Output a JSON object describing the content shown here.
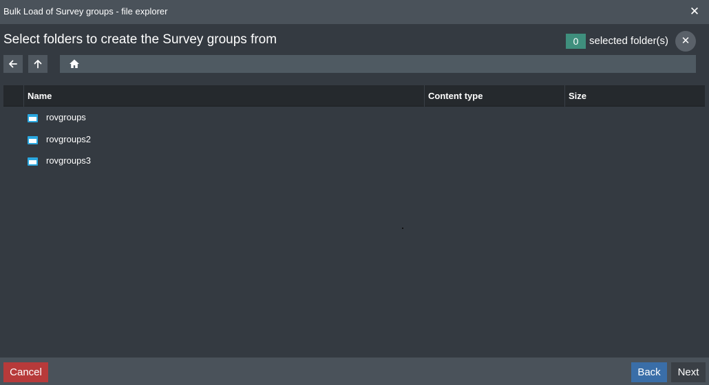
{
  "window": {
    "title": "Bulk Load of Survey groups - file explorer"
  },
  "header": {
    "heading": "Select folders to create the Survey groups from",
    "selected_count": "0",
    "selected_label": "selected folder(s)"
  },
  "table": {
    "columns": [
      "Name",
      "Content type",
      "Size"
    ],
    "rows": [
      {
        "name": "rovgroups",
        "icon": "folder-icon"
      },
      {
        "name": "rovgroups2",
        "icon": "folder-icon"
      },
      {
        "name": "rovgroups3",
        "icon": "folder-icon"
      }
    ]
  },
  "footer": {
    "cancel_label": "Cancel",
    "back_label": "Back",
    "next_label": "Next"
  },
  "colors": {
    "titlebar": "#4a525a",
    "body": "#343a41",
    "accent_teal": "#3f8f7d",
    "cancel_red": "#b73a3a",
    "back_blue": "#3a6ea8",
    "folder_blue": "#2aa8e0"
  }
}
